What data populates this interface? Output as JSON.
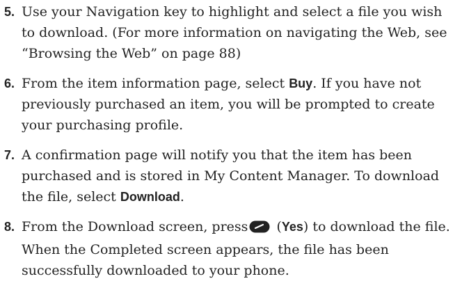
{
  "steps": [
    {
      "number": "5.",
      "text": "Use your Navigation key to highlight and select a file you wish to download. (For more information on navigating the Web, see “Browsing the Web” on page 88)"
    },
    {
      "number": "6.",
      "text_before": "From the item information page, select ",
      "bold": "Buy",
      "text_after": ". If you have not previously purchased an item, you will be prompted to create your purchasing profile."
    },
    {
      "number": "7.",
      "text_before": "A confirmation page will notify you that the item has been purchased and is stored in My Content Manager. To download the file, select ",
      "bold": "Download",
      "text_after": "."
    },
    {
      "number": "8.",
      "text_before": "From the Download screen, press",
      "icon": "softkey-icon",
      "paren_open": " (",
      "bold": "Yes",
      "text_after": ") to download the file. When the Completed screen appears, the file has been successfully downloaded to your phone."
    }
  ]
}
